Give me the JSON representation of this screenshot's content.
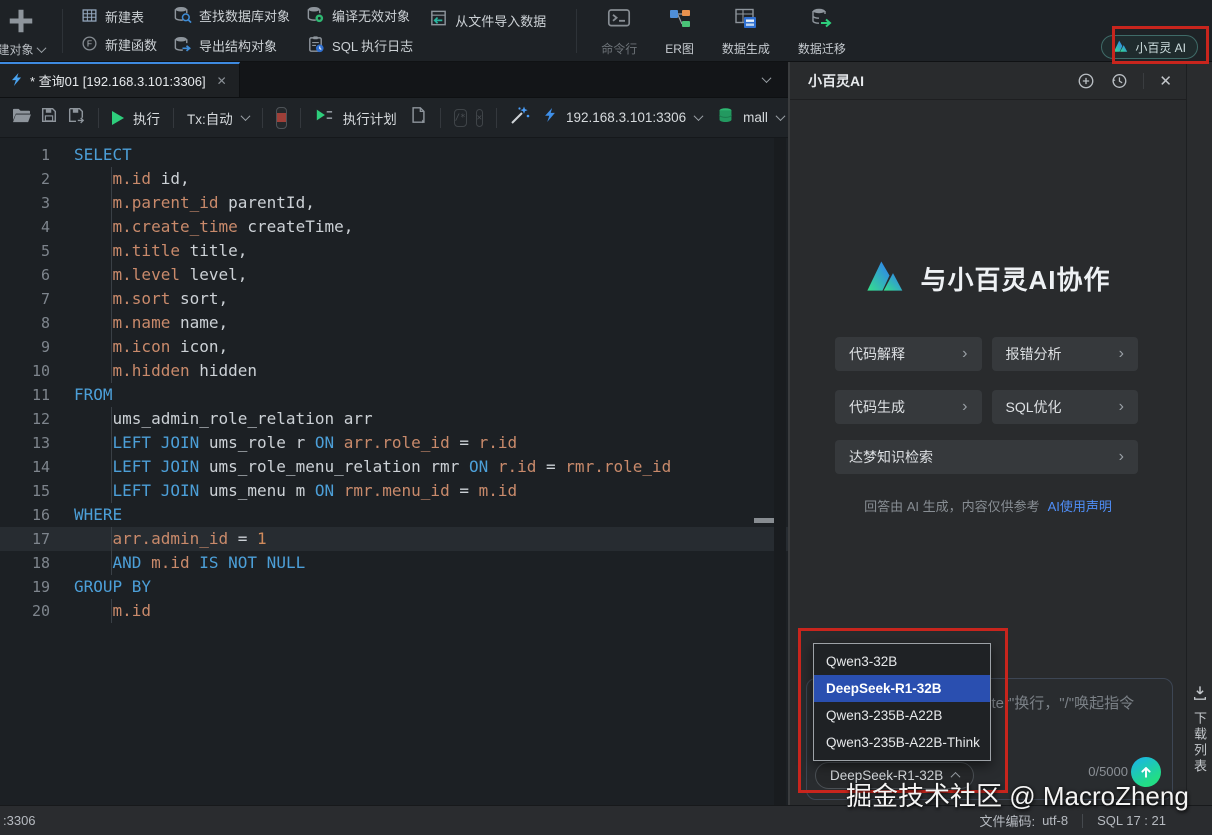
{
  "top_toolbar": {
    "new_object": "建对象",
    "new_table": "新建表",
    "new_function": "新建函数",
    "find_db_object": "查找数据库对象",
    "export_struct": "导出结构对象",
    "compile_invalid": "编译无效对象",
    "sql_log": "SQL 执行日志",
    "import_from_file": "从文件导入数据",
    "command_line": "命令行",
    "er_diagram": "ER图",
    "data_generate": "数据生成",
    "data_migrate": "数据迁移",
    "ai_button": "小百灵 AI"
  },
  "tab": {
    "title": "* 查询01 [192.168.3.101:3306]"
  },
  "editor_toolbar": {
    "run": "执行",
    "tx_mode": "Tx:自动",
    "explain": "执行计划",
    "connection": "192.168.3.101:3306",
    "database": "mall"
  },
  "editor": {
    "current_line": 17,
    "lines": [
      {
        "g": 0,
        "s": [
          [
            "k",
            "SELECT"
          ]
        ]
      },
      {
        "g": 1,
        "s": [
          [
            "p",
            "    "
          ],
          [
            "q",
            "m.id"
          ],
          [
            "p",
            " id,"
          ]
        ]
      },
      {
        "g": 1,
        "s": [
          [
            "p",
            "    "
          ],
          [
            "q",
            "m.parent_id"
          ],
          [
            "p",
            " parentId,"
          ]
        ]
      },
      {
        "g": 1,
        "s": [
          [
            "p",
            "    "
          ],
          [
            "q",
            "m.create_time"
          ],
          [
            "p",
            " createTime,"
          ]
        ]
      },
      {
        "g": 1,
        "s": [
          [
            "p",
            "    "
          ],
          [
            "q",
            "m.title"
          ],
          [
            "p",
            " title,"
          ]
        ]
      },
      {
        "g": 1,
        "s": [
          [
            "p",
            "    "
          ],
          [
            "q",
            "m.level"
          ],
          [
            "p",
            " level,"
          ]
        ]
      },
      {
        "g": 1,
        "s": [
          [
            "p",
            "    "
          ],
          [
            "q",
            "m.sort"
          ],
          [
            "p",
            " sort,"
          ]
        ]
      },
      {
        "g": 1,
        "s": [
          [
            "p",
            "    "
          ],
          [
            "q",
            "m.name"
          ],
          [
            "p",
            " name,"
          ]
        ]
      },
      {
        "g": 1,
        "s": [
          [
            "p",
            "    "
          ],
          [
            "q",
            "m.icon"
          ],
          [
            "p",
            " icon,"
          ]
        ]
      },
      {
        "g": 1,
        "s": [
          [
            "p",
            "    "
          ],
          [
            "q",
            "m.hidden"
          ],
          [
            "p",
            " hidden"
          ]
        ]
      },
      {
        "g": 0,
        "s": [
          [
            "k",
            "FROM"
          ]
        ]
      },
      {
        "g": 1,
        "s": [
          [
            "p",
            "    ums_admin_role_relation arr"
          ]
        ]
      },
      {
        "g": 1,
        "s": [
          [
            "p",
            "    "
          ],
          [
            "k",
            "LEFT JOIN"
          ],
          [
            "p",
            " ums_role r "
          ],
          [
            "k",
            "ON"
          ],
          [
            "p",
            " "
          ],
          [
            "q",
            "arr.role_id"
          ],
          [
            "p",
            " = "
          ],
          [
            "q",
            "r.id"
          ]
        ]
      },
      {
        "g": 1,
        "s": [
          [
            "p",
            "    "
          ],
          [
            "k",
            "LEFT JOIN"
          ],
          [
            "p",
            " ums_role_menu_relation rmr "
          ],
          [
            "k",
            "ON"
          ],
          [
            "p",
            " "
          ],
          [
            "q",
            "r.id"
          ],
          [
            "p",
            " = "
          ],
          [
            "q",
            "rmr.role_id"
          ]
        ]
      },
      {
        "g": 1,
        "s": [
          [
            "p",
            "    "
          ],
          [
            "k",
            "LEFT JOIN"
          ],
          [
            "p",
            " ums_menu m "
          ],
          [
            "k",
            "ON"
          ],
          [
            "p",
            " "
          ],
          [
            "q",
            "rmr.menu_id"
          ],
          [
            "p",
            " = "
          ],
          [
            "q",
            "m.id"
          ]
        ]
      },
      {
        "g": 0,
        "s": [
          [
            "k",
            "WHERE"
          ]
        ]
      },
      {
        "g": 1,
        "s": [
          [
            "p",
            "    "
          ],
          [
            "q",
            "arr.admin_id"
          ],
          [
            "p",
            " = "
          ],
          [
            "n",
            "1"
          ]
        ]
      },
      {
        "g": 1,
        "s": [
          [
            "p",
            "    "
          ],
          [
            "k",
            "AND"
          ],
          [
            "p",
            " "
          ],
          [
            "q",
            "m.id"
          ],
          [
            "p",
            " "
          ],
          [
            "k",
            "IS NOT NULL"
          ]
        ]
      },
      {
        "g": 0,
        "s": [
          [
            "k",
            "GROUP BY"
          ]
        ]
      },
      {
        "g": 1,
        "s": [
          [
            "p",
            "    "
          ],
          [
            "q",
            "m.id"
          ]
        ]
      }
    ]
  },
  "ai_panel": {
    "title": "小百灵AI",
    "hero_title": "与小百灵AI协作",
    "quick_actions": [
      "代码解释",
      "报错分析",
      "代码生成",
      "SQL优化"
    ],
    "wide_action": "达梦知识检索",
    "disclaimer": "回答由 AI 生成，内容仅供参考",
    "disclaimer_link": "AI使用声明",
    "input_placeholder": "\"Shift+Enter\"换行，\"/\"唤起指令",
    "char_counter": "0/5000",
    "model_dropdown": {
      "selected": "DeepSeek-R1-32B",
      "options": [
        "Qwen3-32B",
        "DeepSeek-R1-32B",
        "Qwen3-235B-A22B",
        "Qwen3-235B-A22B-Think"
      ]
    }
  },
  "right_strip": {
    "download_list": "下载列表"
  },
  "status_bar": {
    "left": ":3306",
    "encoding_label": "文件编码:",
    "encoding_value": "utf-8",
    "cursor": "SQL 17 : 21"
  },
  "watermark": "掘金技术社区 @ MacroZheng"
}
